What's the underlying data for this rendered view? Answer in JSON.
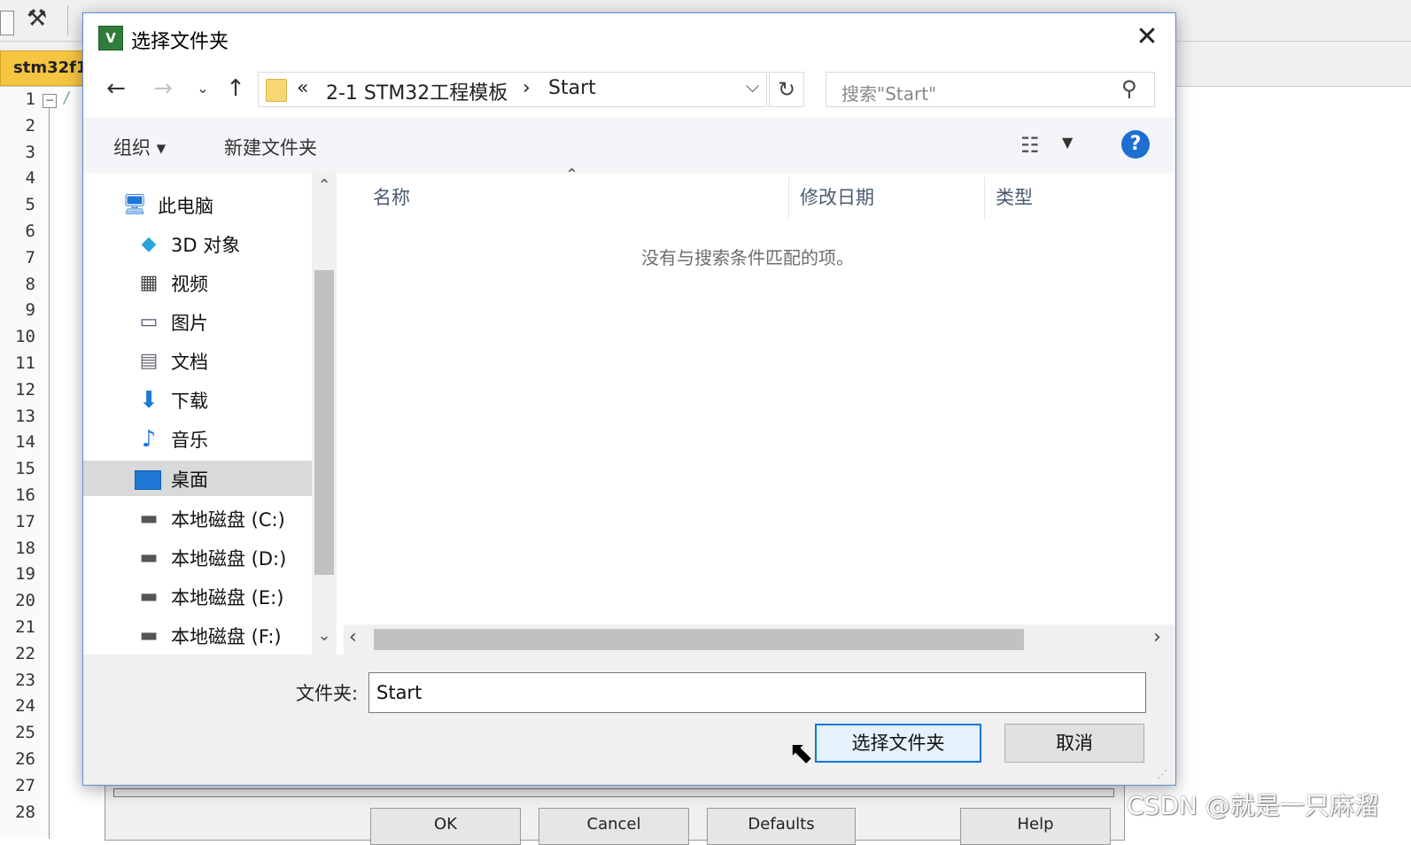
{
  "ide": {
    "tab_label": "stm32f1",
    "line_numbers": [
      "1",
      "2",
      "3",
      "4",
      "5",
      "6",
      "7",
      "8",
      "9",
      "10",
      "11",
      "12",
      "13",
      "14",
      "15",
      "16",
      "17",
      "18",
      "19",
      "20",
      "21",
      "22",
      "23",
      "24",
      "25",
      "26",
      "27",
      "28"
    ],
    "code_line_1": "/",
    "buttons": [
      "OK",
      "Cancel",
      "Defaults",
      "Help"
    ]
  },
  "dialog": {
    "title": "选择文件夹",
    "address": {
      "overflow": "«",
      "segment_1": "2-1 STM32工程模板",
      "separator": "›",
      "segment_2": "Start"
    },
    "search_placeholder": "搜索\"Start\"",
    "commands": {
      "organize": "组织 ▾",
      "new_folder": "新建文件夹"
    },
    "nav_items": [
      {
        "label": "此电脑",
        "icon": "computer-icon"
      },
      {
        "label": "3D 对象",
        "icon": "cube-icon"
      },
      {
        "label": "视频",
        "icon": "video-icon"
      },
      {
        "label": "图片",
        "icon": "picture-icon"
      },
      {
        "label": "文档",
        "icon": "document-icon"
      },
      {
        "label": "下载",
        "icon": "download-icon"
      },
      {
        "label": "音乐",
        "icon": "music-icon"
      },
      {
        "label": "桌面",
        "icon": "desktop-icon"
      },
      {
        "label": "本地磁盘 (C:)",
        "icon": "drive-c-icon"
      },
      {
        "label": "本地磁盘 (D:)",
        "icon": "drive-icon"
      },
      {
        "label": "本地磁盘 (E:)",
        "icon": "drive-icon"
      },
      {
        "label": "本地磁盘 (F:)",
        "icon": "drive-icon"
      }
    ],
    "selected_nav": "桌面",
    "columns": {
      "name": "名称",
      "modified": "修改日期",
      "type": "类型"
    },
    "empty_message": "没有与搜索条件匹配的项。",
    "folder_label": "文件夹:",
    "folder_value": "Start",
    "select_button": "选择文件夹",
    "cancel_button": "取消"
  },
  "watermark": "CSDN @就是一只麻溜",
  "colors": {
    "accent": "#0078d7",
    "tab_yellow": "#f5c542",
    "help_blue": "#1e6fd1"
  }
}
